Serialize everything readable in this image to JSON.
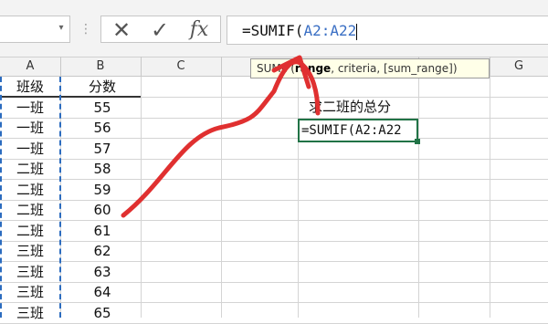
{
  "formula_bar": {
    "cancel_icon": "✕",
    "enter_icon": "✓",
    "fx_label": "fx",
    "formula_prefix": "=SUMIF(",
    "formula_ref": "A2:A22"
  },
  "tooltip": {
    "fn": "SUMIF(",
    "arg1": "range",
    "rest": ", criteria, [sum_range])"
  },
  "columns": [
    "A",
    "B",
    "C",
    "D",
    "E",
    "F",
    "G"
  ],
  "rows": [
    {
      "a": "班级",
      "b": "分数"
    },
    {
      "a": "一班",
      "b": "55"
    },
    {
      "a": "一班",
      "b": "56"
    },
    {
      "a": "一班",
      "b": "57"
    },
    {
      "a": "二班",
      "b": "58"
    },
    {
      "a": "二班",
      "b": "59"
    },
    {
      "a": "二班",
      "b": "60"
    },
    {
      "a": "二班",
      "b": "61"
    },
    {
      "a": "三班",
      "b": "62"
    },
    {
      "a": "三班",
      "b": "63"
    },
    {
      "a": "三班",
      "b": "64"
    },
    {
      "a": "三班",
      "b": "65"
    }
  ],
  "cells": {
    "label": "求二班的总分",
    "active": "=SUMIF(A2:A22"
  },
  "colors": {
    "annotation": "#e03030",
    "selection": "#217346",
    "reference": "#3a6fc4"
  }
}
